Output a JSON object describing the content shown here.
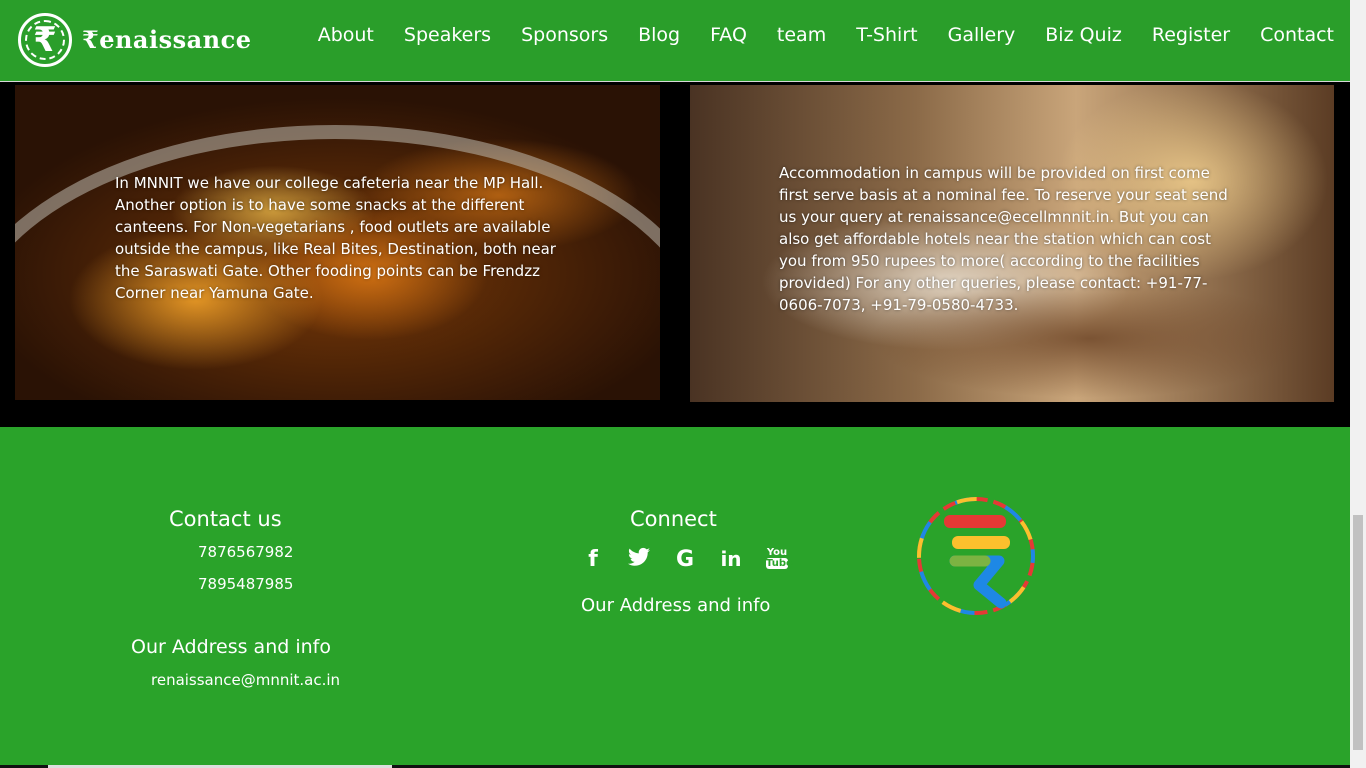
{
  "brand": {
    "logo_text": "₹enaissance",
    "logo_glyph": "₹"
  },
  "nav": {
    "items": [
      "About",
      "Speakers",
      "Sponsors",
      "Blog",
      "FAQ",
      "team",
      "T-Shirt",
      "Gallery",
      "Biz Quiz",
      "Register",
      "Contact"
    ]
  },
  "info": {
    "food_text": "In MNNIT we have our college cafeteria near the MP Hall. Another option is to have some snacks at the different canteens. For Non-vegetarians , food outlets are available outside the campus, like Real Bites, Destination, both near the Saraswati Gate. Other fooding points can be Frendzz Corner near Yamuna Gate.",
    "accommodation_text": "Accommodation in campus will be provided on first come first serve basis at a nominal fee. To reserve your seat send us your query at renaissance@ecellmnnit.in. But you can also get affordable hotels near the station which can cost you from 950 rupees to more( according to the facilities provided) For any other queries, please contact: +91-77-0606-7073, +91-79-0580-4733."
  },
  "footer": {
    "contact_heading": "Contact us",
    "phone_1": "7876567982",
    "phone_2": "7895487985",
    "address_heading": "Our Address and info",
    "email": "renaissance@mnnit.ac.in",
    "connect_heading": "Connect",
    "connect_sub": "Our Address and info",
    "social_icons": [
      "facebook-icon",
      "twitter-icon",
      "google-icon",
      "linkedin-icon",
      "youtube-icon"
    ],
    "youtube_label_1": "You",
    "youtube_label_2": "Tube"
  },
  "colors": {
    "brand_green": "#2a9e2a",
    "footer_green": "#2aa32a"
  }
}
